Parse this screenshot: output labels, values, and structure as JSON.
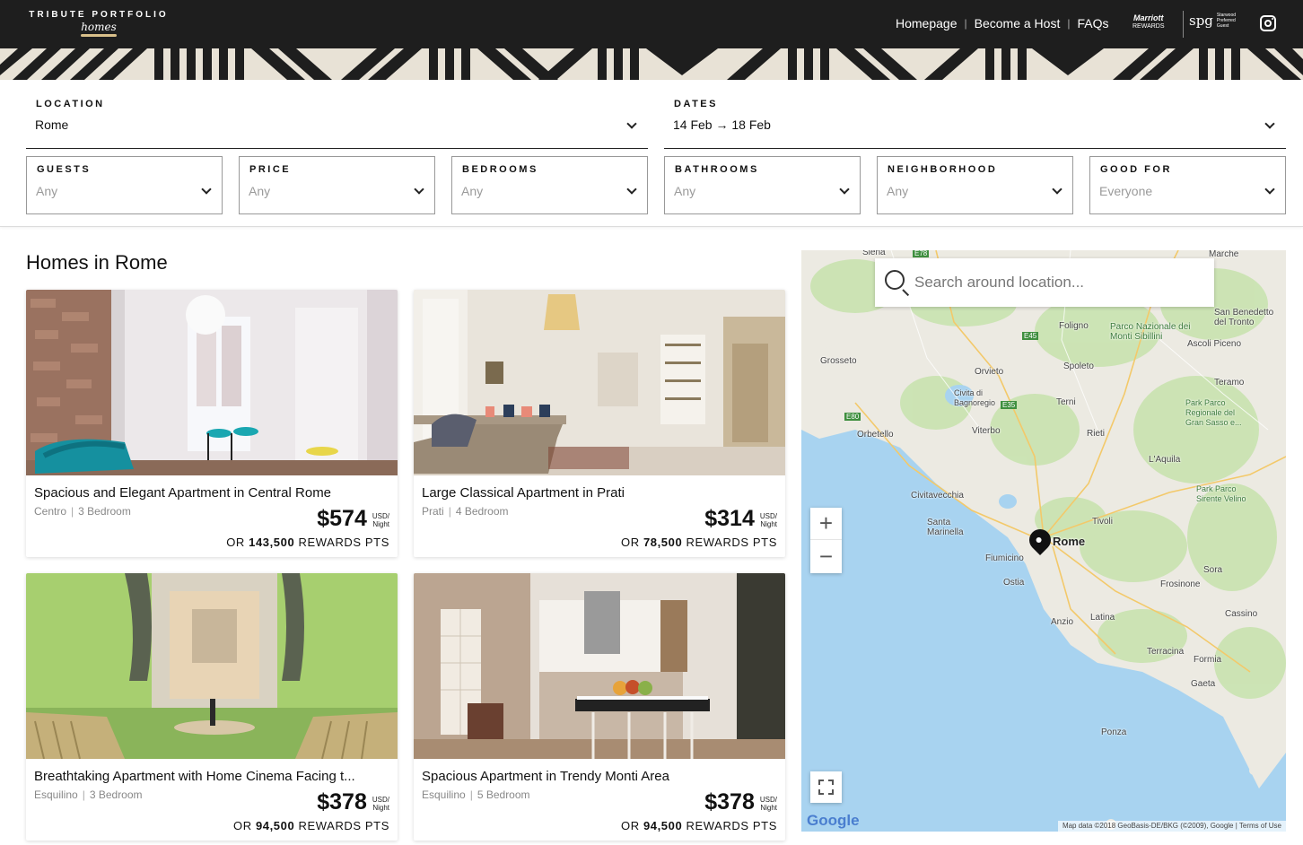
{
  "header": {
    "logo_line1": "TRIBUTE PORTFOLIO",
    "logo_line2": "homes",
    "nav": [
      "Homepage",
      "Become a Host",
      "FAQs"
    ],
    "nav_separator": "|",
    "marriott_name": "Marriott",
    "marriott_sub": "REWARDS",
    "spg_name": "spg",
    "spg_sub": "Starwood Preferred Guest",
    "instagram_icon": "instagram-icon"
  },
  "filters": {
    "location": {
      "label": "LOCATION",
      "value": "Rome"
    },
    "dates": {
      "label": "DATES",
      "value": "14 Feb → 18 Feb"
    },
    "guests": {
      "label": "GUESTS",
      "value": "Any"
    },
    "price": {
      "label": "PRICE",
      "value": "Any"
    },
    "bedrooms": {
      "label": "BEDROOMS",
      "value": "Any"
    },
    "bathrooms": {
      "label": "BATHROOMS",
      "value": "Any"
    },
    "neighborhood": {
      "label": "NEIGHBORHOOD",
      "value": "Any"
    },
    "good_for": {
      "label": "GOOD FOR",
      "value": "Everyone"
    }
  },
  "listings": {
    "heading": "Homes in Rome",
    "items": [
      {
        "title": "Spacious and Elegant Apartment in Central Rome",
        "area": "Centro",
        "bedrooms": "3 Bedroom",
        "price": "$574",
        "unit1": "USD/",
        "unit2": "Night",
        "or": "OR",
        "points": "143,500",
        "points_label": "REWARDS PTS"
      },
      {
        "title": "Large Classical Apartment in Prati",
        "area": "Prati",
        "bedrooms": "4 Bedroom",
        "price": "$314",
        "unit1": "USD/",
        "unit2": "Night",
        "or": "OR",
        "points": "78,500",
        "points_label": "REWARDS PTS"
      },
      {
        "title": "Breathtaking Apartment with Home Cinema Facing t...",
        "area": "Esquilino",
        "bedrooms": "3 Bedroom",
        "price": "$378",
        "unit1": "USD/",
        "unit2": "Night",
        "or": "OR",
        "points": "94,500",
        "points_label": "REWARDS PTS"
      },
      {
        "title": "Spacious Apartment in Trendy Monti Area",
        "area": "Esquilino",
        "bedrooms": "5 Bedroom",
        "price": "$378",
        "unit1": "USD/",
        "unit2": "Night",
        "or": "OR",
        "points": "94,500",
        "points_label": "REWARDS PTS"
      }
    ]
  },
  "map": {
    "search_placeholder": "Search around location...",
    "zoom_in": "+",
    "zoom_out": "−",
    "google": "Google",
    "attribution": "Map data ©2018 GeoBasis-DE/BKG (©2009), Google | Terms of Use",
    "labels": [
      "Siena",
      "Marche",
      "Terni",
      "Foligno",
      "Parco Nazionale dei Monti Sibillini",
      "Ascoli Piceno",
      "San Benedetto del Tronto",
      "Grosseto",
      "Orvieto",
      "Spoleto",
      "Teramo",
      "Civita di Bagnoregio",
      "Viterbo",
      "Rieti",
      "Park Parco Regionale del Gran Sasso e...",
      "Orbetello",
      "L'Aquila",
      "Civitavecchia",
      "Santa Marinella",
      "Tivoli",
      "Park Parco Sirente Velino",
      "Rome",
      "Fiumicino",
      "Ostia",
      "Sora",
      "Frosinone",
      "Anzio",
      "Latina",
      "Cassino",
      "Terracina",
      "Formia",
      "Gaeta",
      "Ponza",
      "E45",
      "E35",
      "E80",
      "E78"
    ]
  }
}
